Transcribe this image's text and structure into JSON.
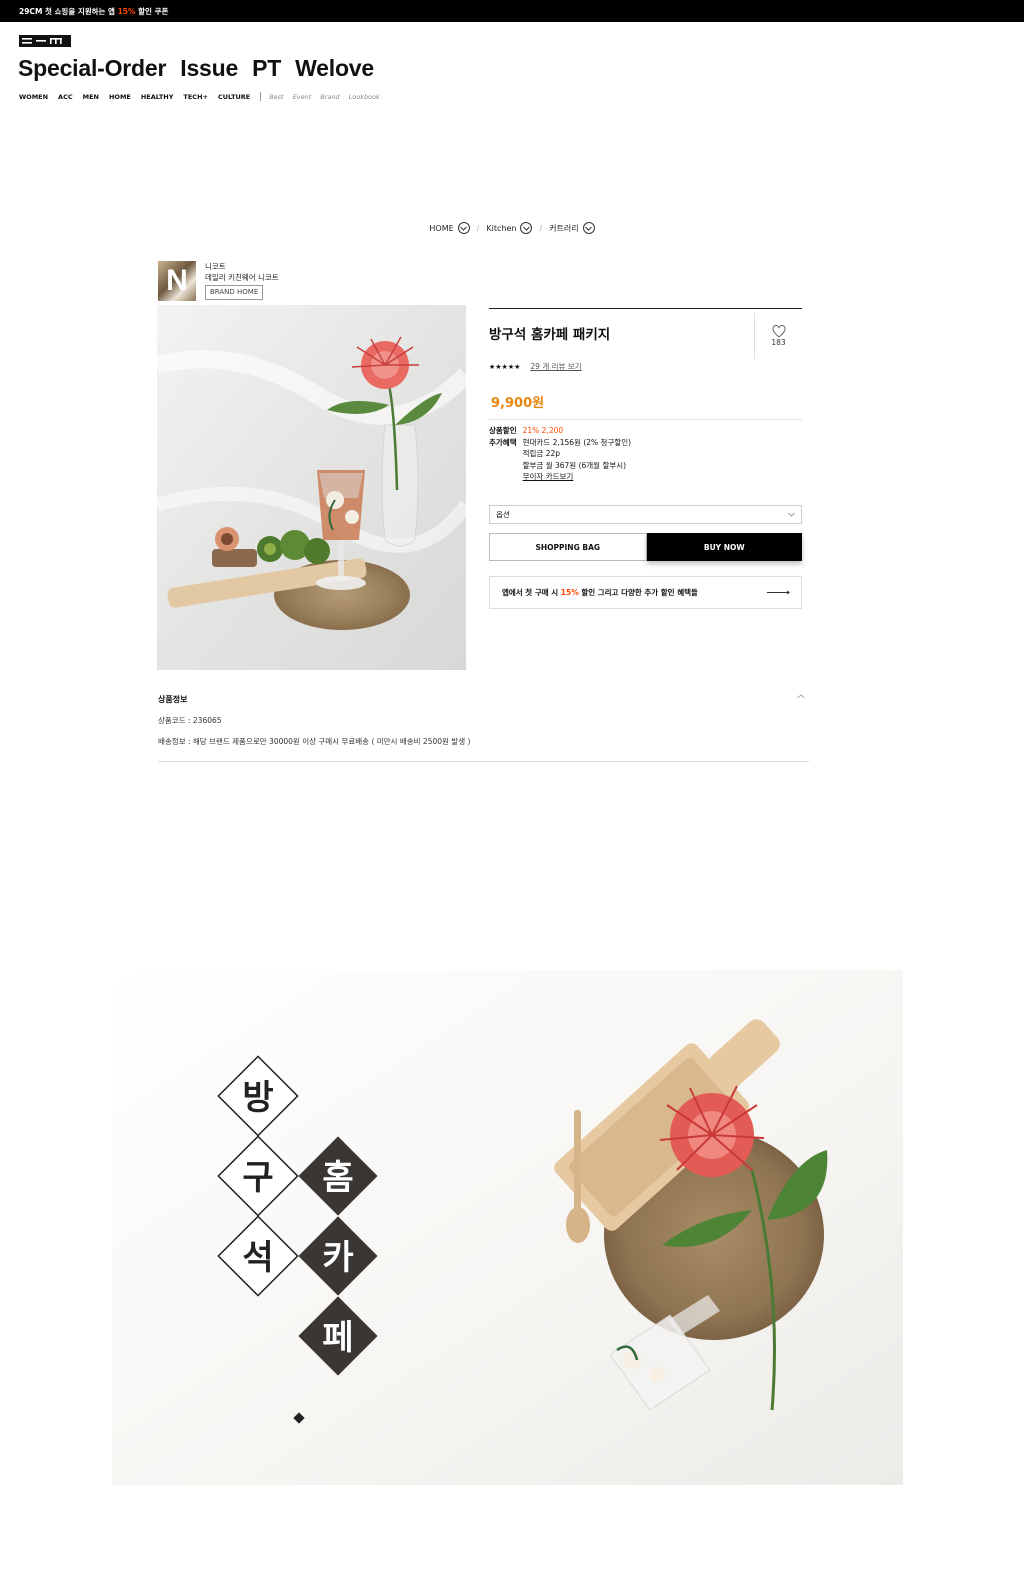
{
  "topbar": {
    "pre": "29CM 첫 쇼핑을 지원하는 앱",
    "highlight": "15%",
    "post": "할인 쿠폰"
  },
  "header": {
    "nav_main": [
      "Special-Order",
      "Issue",
      "PT",
      "Welove"
    ],
    "categories": [
      "WOMEN",
      "ACC",
      "MEN",
      "HOME",
      "HEALTHY",
      "TECH+",
      "CULTURE"
    ],
    "sub_links": [
      "Best",
      "Event",
      "Brand",
      "Lookbook"
    ]
  },
  "breadcrumb": [
    "HOME",
    "Kitchen",
    "커트러리"
  ],
  "brand": {
    "logo_letter": "N",
    "name": "니코트",
    "desc": "데일리 키친웨어 니코트",
    "button": "BRAND HOME"
  },
  "product": {
    "title": "방구석 홈카페 패키지",
    "likes": "183",
    "stars": "★★★★★",
    "review_link": "29 개 리뷰 보기",
    "price": "9,900원",
    "benefits": {
      "discount_label": "상품할인",
      "discount_value": "21% 2,200",
      "extra_label": "추가혜택",
      "extra_lines": [
        "현대카드 2,156원 (2% 청구할인)",
        "적립금 22p",
        "할부금 월 367원 (6개월 할부시)"
      ],
      "card_link": "무이자 카드보기"
    },
    "option_label": "옵션",
    "shopping_bag": "SHOPPING BAG",
    "buy_now": "BUY NOW",
    "app_banner": {
      "pre": "앱에서 첫 구매 시",
      "highlight": "15%",
      "post": "할인 그리고 다양한 추가 할인 혜택들"
    }
  },
  "product_info": {
    "heading": "상품정보",
    "code_line": "상품코드 : 236065",
    "shipping_line": "배송정보 : 해당 브랜드 제품으로만 30000원 이상 구매시 무료배송 ( 미만시 배송비 2500원 발생 )"
  },
  "detail_banner": {
    "chars": [
      "방",
      "구",
      "석",
      "홈",
      "카",
      "페"
    ]
  },
  "colors": {
    "accent": "#ff4800",
    "price": "#e8860e",
    "buy_bg": "#000000"
  }
}
